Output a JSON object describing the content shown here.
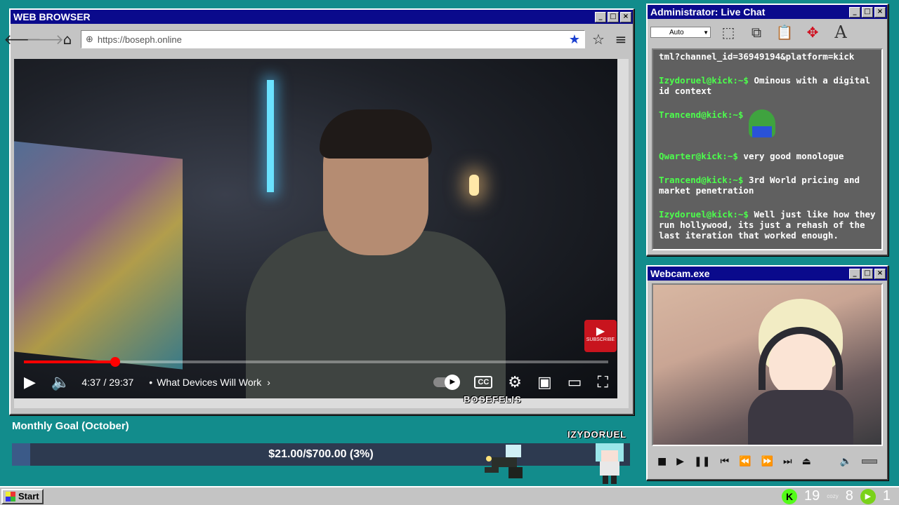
{
  "browser": {
    "title": "WEB BROWSER",
    "url": "https://boseph.online",
    "video": {
      "time": "4:37 / 29:37",
      "chapter": "What Devices Will Work",
      "progress": 0.156,
      "subscribe_label": "SUBSCRIBE",
      "cc_label": "CC"
    }
  },
  "overlay": {
    "streamer_name": "BOSEFELIS",
    "goal": {
      "title": "Monthly Goal (October)",
      "text": "$21.00/$700.00 (3%)",
      "progress": 0.03
    },
    "sprite_name": "IZYDORUEL"
  },
  "chat": {
    "title": "Administrator: Live Chat",
    "dropdown_value": "Auto",
    "top_line": "tml?channel_id=36949194&platform=kick",
    "messages": [
      {
        "user": "Izydoruel@kick:~$",
        "text": "Ominous with a digital id context"
      },
      {
        "user": "Trancend@kick:~$",
        "text": "",
        "emote": true
      },
      {
        "user": "Qwarter@kick:~$",
        "text": "very good monologue"
      },
      {
        "user": "Trancend@kick:~$",
        "text": "3rd World pricing and market penetration"
      },
      {
        "user": "Izydoruel@kick:~$",
        "text": "Well just like how they run hollywood, its just a rehash of the last iteration that worked enough."
      }
    ]
  },
  "webcam": {
    "title": "Webcam.exe"
  },
  "taskbar": {
    "start_label": "Start",
    "tray_count1": "19",
    "tray_cozy": "cozy",
    "tray_count2": "8",
    "tray_count3": "1"
  },
  "colors": {
    "desktop": "#128c8c",
    "titlebar": "#0a0a8c",
    "chat_user": "#4cff4c",
    "progress_red": "#ff0000"
  }
}
